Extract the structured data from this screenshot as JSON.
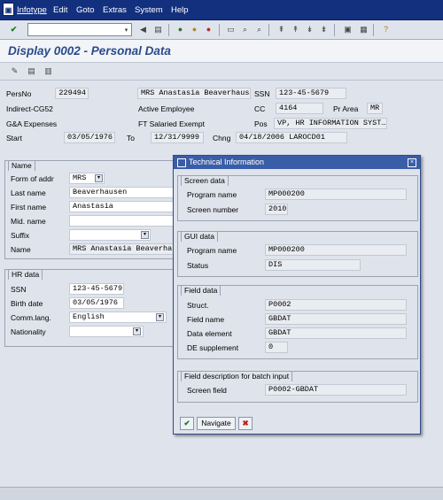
{
  "menubar": {
    "items": [
      "Infotype",
      "Edit",
      "Goto",
      "Extras",
      "System",
      "Help"
    ]
  },
  "toolbar": {
    "command_value": ""
  },
  "title": "Display 0002 - Personal Data",
  "header": {
    "persno_label": "PersNo",
    "persno": "229494",
    "name_value": "MRS Anastasia Beaverhaus",
    "ssn_label": "SSN",
    "ssn": "123-45-5679",
    "org": "Indirect-CG52",
    "employee_status": "Active Employee",
    "cc_label": "CC",
    "cc": "4164",
    "prarea_label": "Pr Area",
    "prarea": "MR",
    "expenses": "G&A Expenses",
    "salaried": "FT Salaried Exempt",
    "pos_label": "Pos",
    "pos": "VP, HR INFORMATION SYST…",
    "start_label": "Start",
    "start": "03/05/1976",
    "to_label": "To",
    "to": "12/31/9999",
    "chng_label": "Chng",
    "chng": "04/18/2006 LAROCD01"
  },
  "name_group": {
    "title": "Name",
    "form_label": "Form of addr",
    "form_value": "MRS",
    "last_label": "Last name",
    "last_value": "Beaverhausen",
    "first_label": "First name",
    "first_value": "Anastasia",
    "mid_label": "Mid. name",
    "mid_value": "",
    "suffix_label": "Suffix",
    "suffix_value": "",
    "name_label": "Name",
    "name_value": "MRS Anastasia Beaverhaus"
  },
  "hr_group": {
    "title": "HR data",
    "ssn_label": "SSN",
    "ssn_value": "123-45-5679",
    "birth_label": "Birth date",
    "birth_value": "03/05/1976",
    "lang_label": "Comm.lang.",
    "lang_value": "English",
    "nat_label": "Nationality",
    "nat_value": ""
  },
  "popup": {
    "title": "Technical Information",
    "screen": {
      "title": "Screen data",
      "program_label": "Program name",
      "program_value": "MP000200",
      "number_label": "Screen number",
      "number_value": "2010"
    },
    "gui": {
      "title": "GUI data",
      "program_label": "Program name",
      "program_value": "MP000200",
      "status_label": "Status",
      "status_value": "DIS"
    },
    "field": {
      "title": "Field data",
      "struct_label": "Struct.",
      "struct_value": "P0002",
      "fname_label": "Field name",
      "fname_value": "GBDAT",
      "delem_label": "Data element",
      "delem_value": "GBDAT",
      "desup_label": "DE supplement",
      "desup_value": "0"
    },
    "batch": {
      "title": "Field description for batch input",
      "screen_label": "Screen field",
      "screen_value": "P0002-GBDAT"
    },
    "navigate_label": "Navigate"
  },
  "colors": {
    "menubar": "#13307f",
    "title": "#2a4b8b",
    "popup_title": "#3a5da7"
  }
}
